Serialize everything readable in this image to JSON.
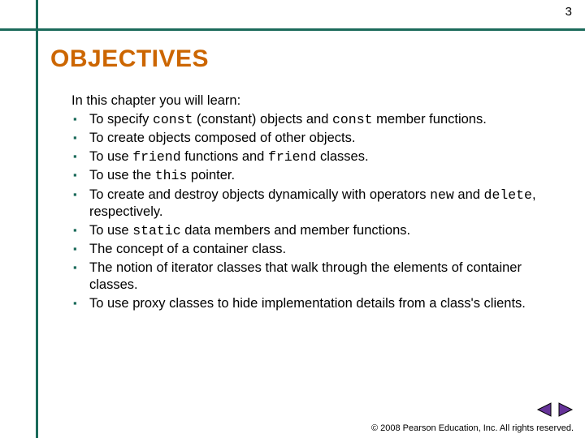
{
  "page_number": "3",
  "title": "OBJECTIVES",
  "intro": "In this chapter you will learn:",
  "items": [
    [
      {
        "t": "To specify "
      },
      {
        "t": "const",
        "mono": true
      },
      {
        "t": " (constant) objects and "
      },
      {
        "t": "const",
        "mono": true
      },
      {
        "t": " member functions."
      }
    ],
    [
      {
        "t": "To create objects composed of other objects."
      }
    ],
    [
      {
        "t": "To use "
      },
      {
        "t": "friend",
        "mono": true
      },
      {
        "t": " functions and "
      },
      {
        "t": "friend",
        "mono": true
      },
      {
        "t": " classes."
      }
    ],
    [
      {
        "t": "To use the "
      },
      {
        "t": "this",
        "mono": true
      },
      {
        "t": " pointer."
      }
    ],
    [
      {
        "t": "To create and destroy objects dynamically with operators "
      },
      {
        "t": "new",
        "mono": true
      },
      {
        "t": " and "
      },
      {
        "t": "delete",
        "mono": true
      },
      {
        "t": ", respectively."
      }
    ],
    [
      {
        "t": "To use "
      },
      {
        "t": "static",
        "mono": true
      },
      {
        "t": " data members and member functions."
      }
    ],
    [
      {
        "t": "The concept of a container class."
      }
    ],
    [
      {
        "t": "The notion of iterator classes that walk through the elements of container classes."
      }
    ],
    [
      {
        "t": "To use proxy classes to hide implementation details from a class's clients."
      }
    ]
  ],
  "footer": "2008 Pearson Education, Inc.  All rights reserved.",
  "copyright_symbol": "©",
  "colors": {
    "accent": "#1b6a5a",
    "title": "#cc6600",
    "nav_fill": "#663399",
    "nav_border": "#000000"
  }
}
